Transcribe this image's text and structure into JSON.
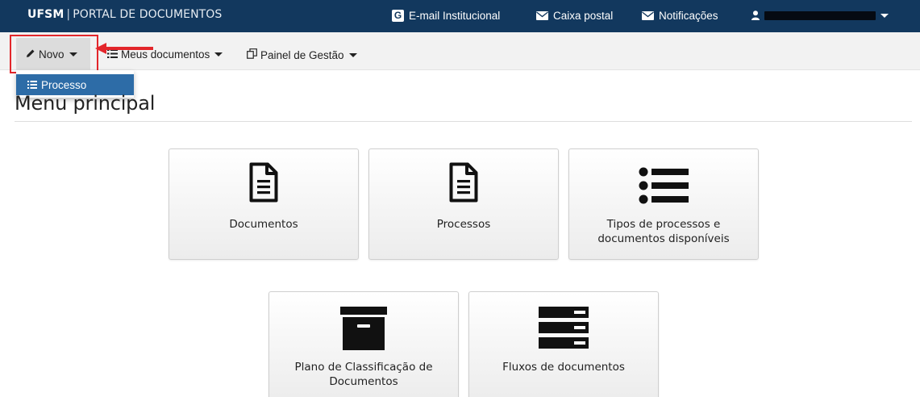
{
  "header": {
    "brand_bold": "UFSM",
    "brand_separator": "|",
    "brand_rest": "PORTAL DE DOCUMENTOS",
    "links": [
      {
        "label": "E-mail Institucional",
        "icon": "google-icon"
      },
      {
        "label": "Caixa postal",
        "icon": "envelope-icon"
      },
      {
        "label": "Notificações",
        "icon": "envelope-icon"
      }
    ],
    "user_icon": "user-icon"
  },
  "nav": {
    "items": [
      {
        "label": "Novo",
        "icon": "pencil-icon"
      },
      {
        "label": "Meus documentos",
        "icon": "list-icon"
      },
      {
        "label": "Painel de Gestão",
        "icon": "copy-icon"
      }
    ],
    "dropdown": {
      "items": [
        {
          "label": "Processo",
          "icon": "list-ordered-icon"
        }
      ]
    }
  },
  "page": {
    "title": "Menu principal"
  },
  "tiles": [
    {
      "lines": [
        "Documentos"
      ],
      "icon": "file-text-icon"
    },
    {
      "lines": [
        "Processos"
      ],
      "icon": "file-text-icon"
    },
    {
      "lines": [
        "Tipos de processos e",
        "documentos disponíveis"
      ],
      "icon": "list-icon"
    },
    {
      "lines": [
        "Plano de Classificação de",
        "Documentos"
      ],
      "icon": "archive-icon"
    },
    {
      "lines": [
        "Fluxos de documentos"
      ],
      "icon": "server-icon"
    }
  ],
  "colors": {
    "header_bg": "#12385e",
    "dropdown_item_bg": "#2d6ca7",
    "highlight": "#e3262b"
  }
}
